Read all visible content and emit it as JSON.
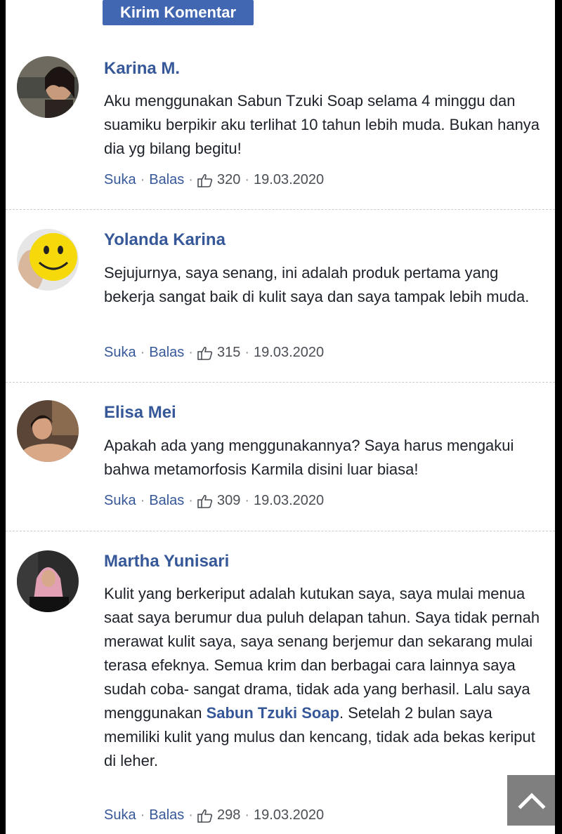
{
  "submit_label": "Kirim Komentar",
  "meta_labels": {
    "like": "Suka",
    "reply": "Balas",
    "dot": "·"
  },
  "comments": [
    {
      "name": "Karina M.",
      "text": "Aku menggunakan Sabun Tzuki Soap selama 4 minggu dan suamiku berpikir aku terlihat 10 tahun lebih muda. Bukan hanya dia yg bilang begitu!",
      "likes": "320",
      "date": "19.03.2020"
    },
    {
      "name": "Yolanda Karina",
      "text": "Sejujurnya, saya senang, ini adalah produk pertama yang bekerja sangat baik di kulit saya dan saya tampak lebih muda.",
      "likes": "315",
      "date": "19.03.2020"
    },
    {
      "name": "Elisa Mei",
      "text": "Apakah ada yang menggunakannya? Saya harus mengakui bahwa metamorfosis Karmila disini luar biasa!",
      "likes": "309",
      "date": "19.03.2020"
    },
    {
      "name": "Martha Yunisari",
      "text_before": "Kulit yang berkeriput adalah kutukan saya, saya mulai menua saat saya berumur dua puluh delapan tahun. Saya tidak pernah merawat kulit saya, saya senang berjemur dan sekarang mulai terasa efeknya. Semua krim dan berbagai cara lainnya saya sudah coba- sangat drama, tidak ada yang berhasil. Lalu saya menggunakan ",
      "text_link": "Sabun Tzuki Soap",
      "text_after": ". Setelah 2 bulan saya memiliki kulit yang mulus dan kencang, tidak ada bekas keriput di leher.",
      "likes": "298",
      "date": "19.03.2020"
    }
  ],
  "icons": {
    "thumb": "thumbs-up-icon",
    "scroll_top": "chevron-up-icon"
  },
  "colors": {
    "button": "#4267b2",
    "name": "#365899",
    "link": "#365899",
    "scroll_button": "#7f7f7f"
  }
}
